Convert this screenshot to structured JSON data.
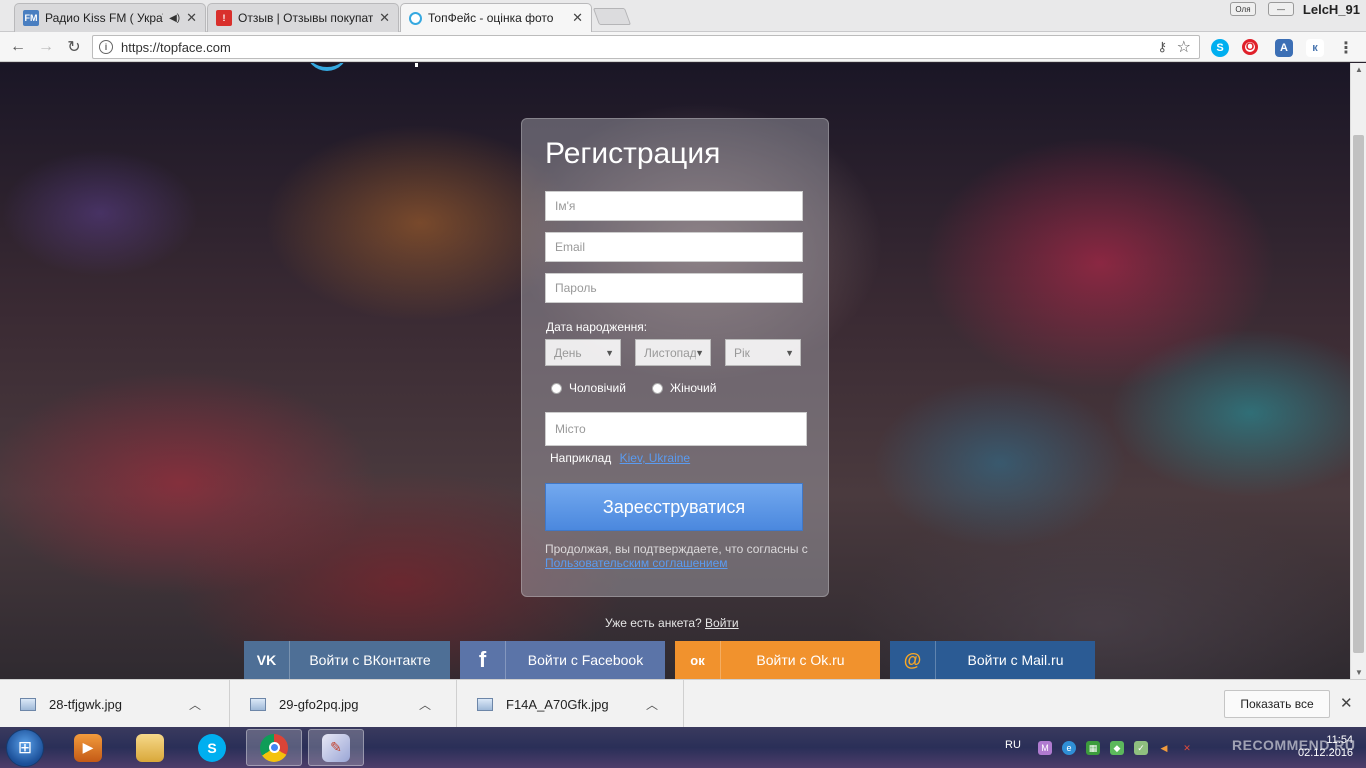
{
  "browser": {
    "tabs": [
      {
        "favicon": "FM",
        "title": "Радио Kiss FM ( Украї",
        "favicon_color": "#4a7fc1"
      },
      {
        "favicon": "!",
        "title": "Отзыв | Отзывы покупат",
        "favicon_color": "#d9302c"
      },
      {
        "favicon": "",
        "title": "ТопФейс - оцінка фото",
        "favicon_color": "#35a8e0"
      }
    ],
    "user": "LelcH_91",
    "url": "https://topface.com"
  },
  "page": {
    "register": {
      "title": "Регистрация",
      "name_placeholder": "Ім'я",
      "email_placeholder": "Email",
      "password_placeholder": "Пароль",
      "birth_label": "Дата народження:",
      "day": "День",
      "month": "Листопад",
      "year": "Рік",
      "gender_male": "Чоловічий",
      "gender_female": "Жіночий",
      "city_placeholder": "Місто",
      "example_label": "Наприклад",
      "example_link": "Kiev, Ukraine",
      "submit": "Зареєструватися",
      "terms_text": "Продолжая, вы подтверждаете, что согласны с",
      "terms_link": "Пользовательским соглашением"
    },
    "login_prompt": "Уже есть анкета?",
    "login_link": "Войти",
    "social": [
      {
        "icon": "vk-icon",
        "glyph": "VK",
        "label": "Войти с ВКонтакте",
        "color": "#4e6f96"
      },
      {
        "icon": "facebook-icon",
        "glyph": "f",
        "label": "Войти с Facebook",
        "color": "#5b74a8"
      },
      {
        "icon": "odnoklassniki-icon",
        "glyph": "ок",
        "label": "Войти с Ok.ru",
        "color": "#f1922d"
      },
      {
        "icon": "mailru-icon",
        "glyph": "@",
        "label": "Войти с Mail.ru",
        "color": "#2b5b94"
      }
    ]
  },
  "downloads": {
    "items": [
      "28-tfjgwk.jpg",
      "29-gfo2pq.jpg",
      "F14A_A70Gfk.jpg"
    ],
    "show_all": "Показать все"
  },
  "taskbar": {
    "lang": "RU",
    "time": "11:54",
    "date": "02.12.2016",
    "watermark": "RECOMMEND.RU"
  }
}
